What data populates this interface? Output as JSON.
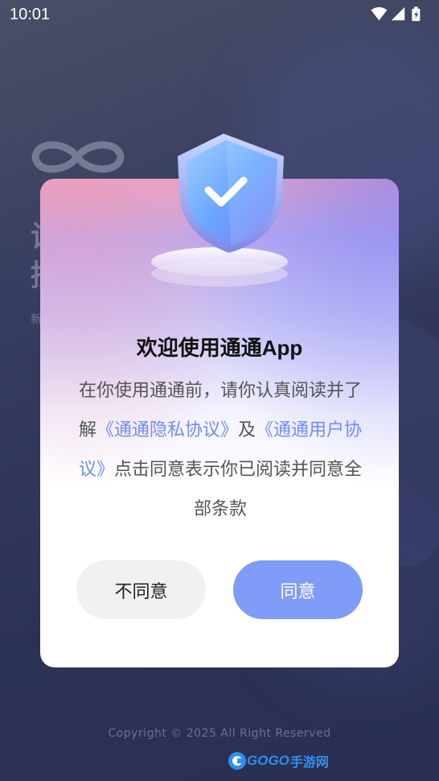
{
  "status_bar": {
    "time": "10:01",
    "icons": [
      "wifi-icon",
      "signal-icon",
      "battery-charging-icon"
    ]
  },
  "background": {
    "logo": "infinity-logo-icon",
    "title_partial": "设\n授",
    "subtitle_partial": "新"
  },
  "dialog": {
    "title": "欢迎使用通通App",
    "body_prefix": "在你使用通通前，请你认真阅读并了解",
    "privacy_link": "《通通隐私协议》",
    "conjunction": "及",
    "user_link": "《通通用户协议》",
    "body_suffix": "点击同意表示你已阅读并同意全部条款",
    "disagree_label": "不同意",
    "agree_label": "同意"
  },
  "footer": {
    "copyright": "Copyright © 2025 All Right Reserved",
    "watermark_brand": "GOGO",
    "watermark_cn": "手游网"
  },
  "colors": {
    "link": "#6f8df7",
    "agree_button": "#7f9cf9",
    "disagree_button": "#f1f1f4"
  }
}
